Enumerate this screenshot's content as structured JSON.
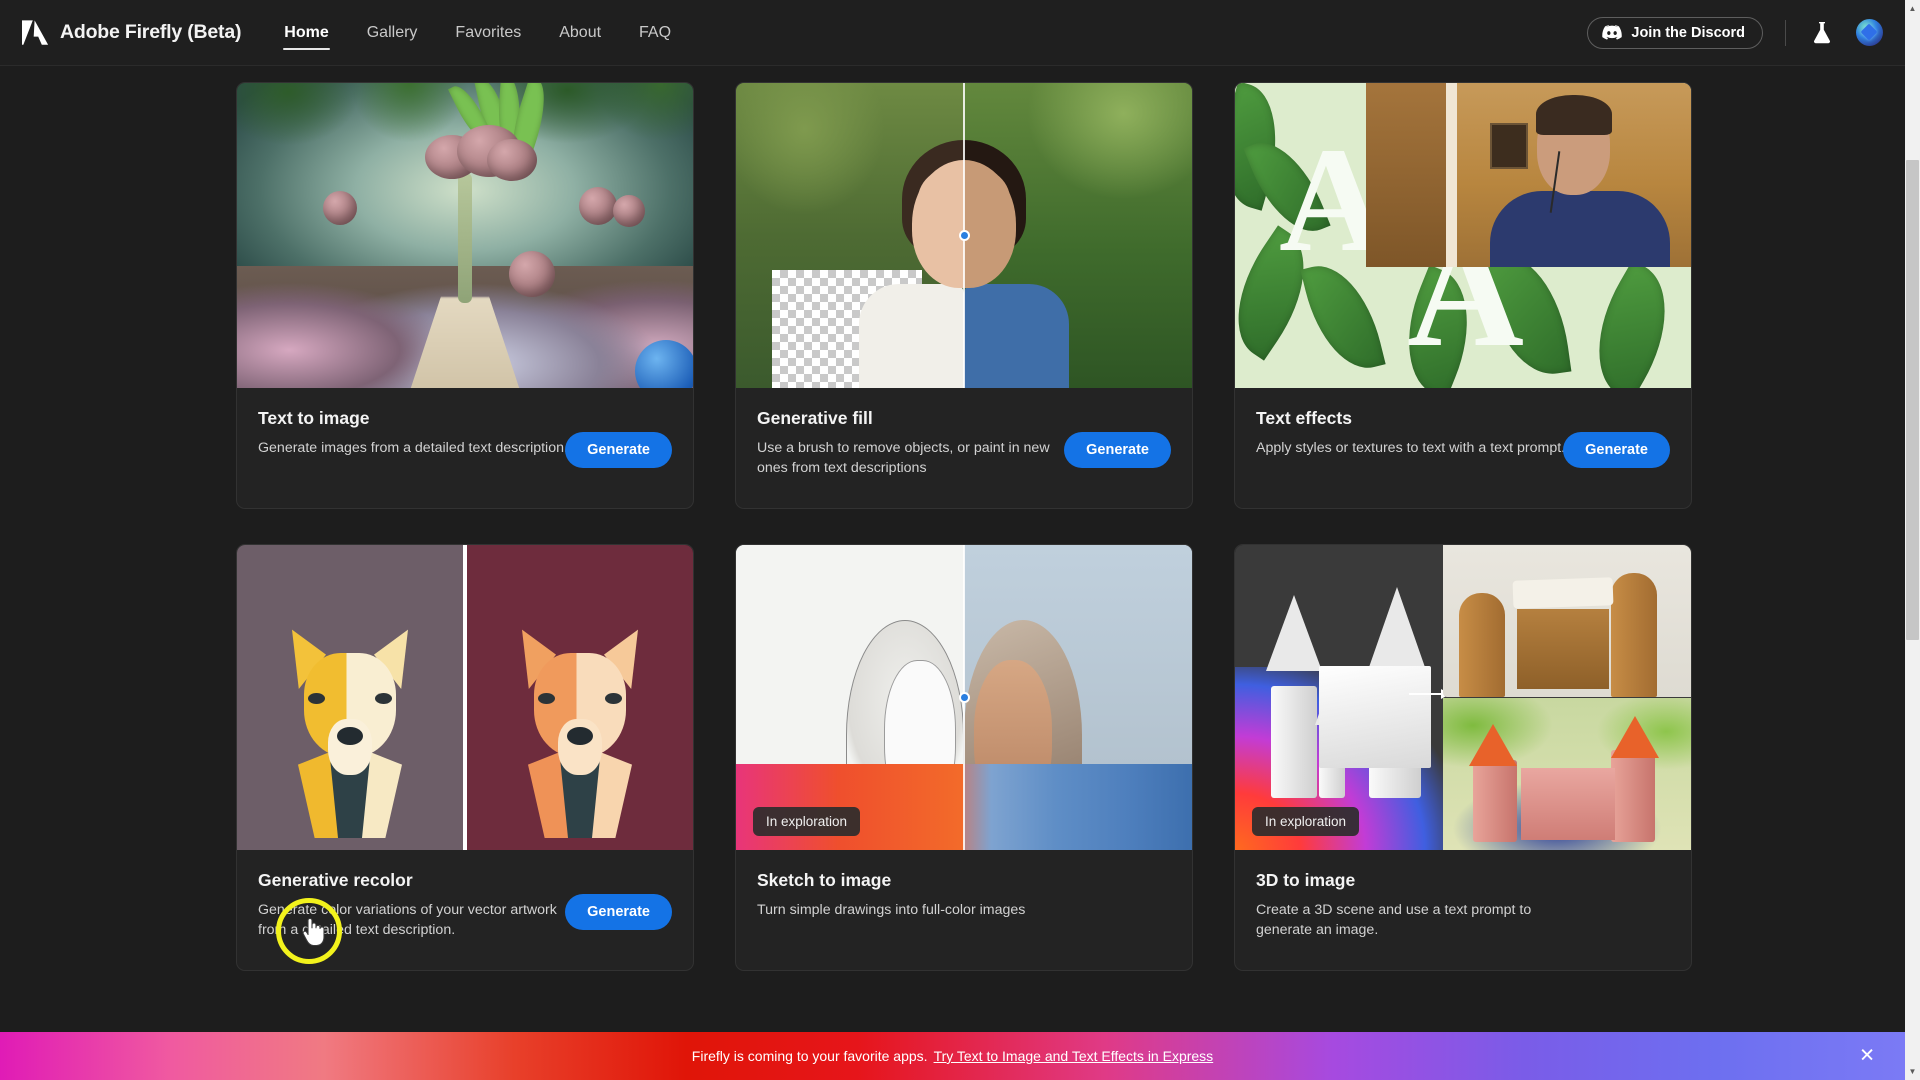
{
  "header": {
    "brand_title": "Adobe Firefly (Beta)",
    "logo_icon": "adobe-a-logo-icon",
    "nav": [
      {
        "label": "Home",
        "active": true
      },
      {
        "label": "Gallery",
        "active": false
      },
      {
        "label": "Favorites",
        "active": false
      },
      {
        "label": "About",
        "active": false
      },
      {
        "label": "FAQ",
        "active": false
      }
    ],
    "discord_label": "Join the Discord",
    "discord_icon": "discord-icon",
    "beaker_icon": "beaker-icon",
    "avatar_icon": "user-avatar-icon"
  },
  "cards": [
    {
      "title": "Text to image",
      "description": "Generate images from a detailed text description.",
      "button": "Generate",
      "badge": null,
      "art": "fantasy-garden-image"
    },
    {
      "title": "Generative fill",
      "description": "Use a brush to remove objects, or paint in new ones from text descriptions",
      "button": "Generate",
      "badge": null,
      "art": "portrait-before-after-image"
    },
    {
      "title": "Text effects",
      "description": "Apply styles or textures to text with a text prompt.",
      "button": "Generate",
      "badge": null,
      "art": "leafy-text-effect-image"
    },
    {
      "title": "Generative recolor",
      "description": "Generate color variations of your vector artwork from a detailed text description.",
      "button": "Generate",
      "badge": null,
      "art": "vector-dog-recolor-image"
    },
    {
      "title": "Sketch to image",
      "description": "Turn simple drawings into full-color images",
      "button": null,
      "badge": "In exploration",
      "art": "sketch-portrait-image"
    },
    {
      "title": "3D to image",
      "description": "Create a 3D scene and use a text prompt to generate an image.",
      "button": null,
      "badge": "In exploration",
      "art": "castle-3d-render-image"
    }
  ],
  "banner": {
    "text": "Firefly is coming to your favorite apps.",
    "link": "Try Text to Image and Text Effects in Express",
    "close_icon": "close-icon"
  },
  "scrollbar": {
    "up_arrow": "▲",
    "down_arrow": "▼"
  },
  "overlay": {
    "webcam": "presenter-webcam-video",
    "cursor": "hand-cursor-highlight"
  },
  "colors": {
    "accent_blue": "#1473e6",
    "page_bg": "#1d1d1d",
    "card_bg": "#232323",
    "cursor_ring": "#f2f21c"
  }
}
